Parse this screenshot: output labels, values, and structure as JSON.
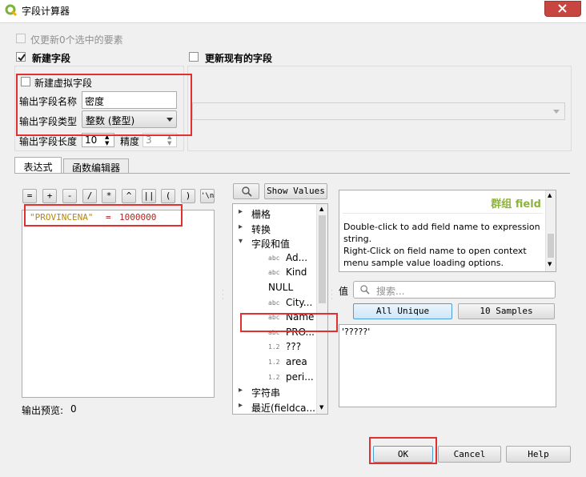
{
  "window": {
    "title": "字段计算器"
  },
  "update_selected_label": "仅更新0个选中的要素",
  "new_field": {
    "checkbox_label": "新建字段",
    "virtual_label": "新建虚拟字段",
    "name_label": "输出字段名称",
    "name_value": "密度",
    "type_label": "输出字段类型",
    "type_value": "整数 (整型)",
    "length_label": "输出字段长度",
    "length_value": "10",
    "precision_label": "精度",
    "precision_value": "3"
  },
  "update_existing": {
    "checkbox_label": "更新现有的字段"
  },
  "tabs": [
    "表达式",
    "函数编辑器"
  ],
  "operators": [
    "=",
    "+",
    "-",
    "/",
    "*",
    "^",
    "||",
    "(",
    ")",
    "'\\n'"
  ],
  "expression": {
    "field": "\"PROVINCENA\"",
    "operator": "=",
    "value": "1000000"
  },
  "output_preview": {
    "label": "输出预览:",
    "value": "0"
  },
  "function_list": {
    "show_values_label": "Show Values",
    "items": [
      {
        "label": "栅格",
        "arrow": "▸",
        "kind": "group"
      },
      {
        "label": "转换",
        "arrow": "▸",
        "kind": "group"
      },
      {
        "label": "字段和值",
        "arrow": "▾",
        "kind": "group"
      },
      {
        "label": "Ad...",
        "type": "abc",
        "kind": "field"
      },
      {
        "label": "Kind",
        "type": "abc",
        "kind": "field"
      },
      {
        "label": "NULL",
        "type": "",
        "kind": "field"
      },
      {
        "label": "City...",
        "type": "abc",
        "kind": "field"
      },
      {
        "label": "Name",
        "type": "abc",
        "kind": "field"
      },
      {
        "label": "PRO...",
        "type": "abc",
        "kind": "field"
      },
      {
        "label": "???",
        "type": "1.2",
        "kind": "field"
      },
      {
        "label": "area",
        "type": "1.2",
        "kind": "field"
      },
      {
        "label": "peri...",
        "type": "1.2",
        "kind": "field"
      },
      {
        "label": "字符串",
        "arrow": "▸",
        "kind": "group"
      },
      {
        "label": "最近(fieldca...",
        "arrow": "▸",
        "kind": "group"
      }
    ]
  },
  "help_panel": {
    "title": "群组 field",
    "line1": "Double-click to add field name to expression",
    "line2": "string.",
    "line3": "Right-Click on field name to open context",
    "line4": "menu sample value loading options."
  },
  "values": {
    "label": "值",
    "search_placeholder": "搜索...",
    "all_unique_label": "All Unique",
    "samples_label": "10 Samples",
    "items": [
      "'?????'"
    ]
  },
  "buttons": {
    "ok": "OK",
    "cancel": "Cancel",
    "help": "Help"
  },
  "colors": {
    "expr_field": "#b8860b",
    "expr_value": "#b22222",
    "help_title": "#8db33a",
    "highlight": "#e03030"
  }
}
